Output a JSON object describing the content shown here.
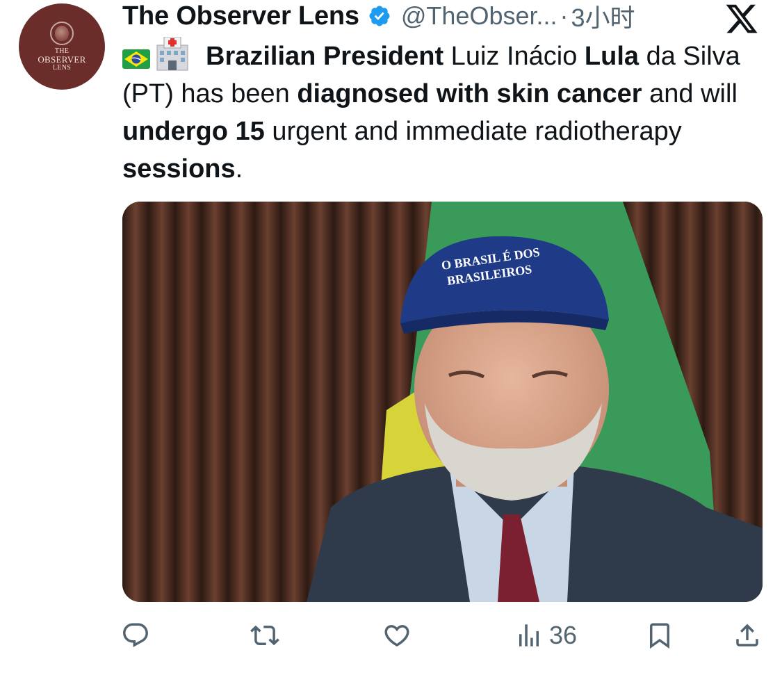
{
  "author": {
    "display_name": "The Observer Lens",
    "handle": "@TheObser...",
    "separator": "·",
    "time": "3小时",
    "avatar_text": [
      "THE",
      "OBSERVER",
      "LENS"
    ],
    "verified_color": "#1d9bf0"
  },
  "tweet": {
    "segments": [
      {
        "text": "Brazilian President",
        "bold": true
      },
      {
        "text": " Luiz Inácio ",
        "bold": false
      },
      {
        "text": "Lula",
        "bold": true
      },
      {
        "text": " da Silva (PT) has been ",
        "bold": false
      },
      {
        "text": "diagnosed with skin cancer",
        "bold": true
      },
      {
        "text": " and will ",
        "bold": false
      },
      {
        "text": "undergo 15",
        "bold": true
      },
      {
        "text": " urgent and immediate radiotherapy ",
        "bold": false
      },
      {
        "text": "sessions",
        "bold": true
      },
      {
        "text": ".",
        "bold": false
      }
    ],
    "emojis": [
      "brazil-flag-emoji",
      "hospital-emoji"
    ]
  },
  "media": {
    "cap_text_line1": "O BRASIL É DOS",
    "cap_text_line2": "BRASILEIROS"
  },
  "actions": {
    "reply": {
      "icon": "reply-icon",
      "count": ""
    },
    "retweet": {
      "icon": "retweet-icon",
      "count": ""
    },
    "like": {
      "icon": "heart-icon",
      "count": ""
    },
    "views": {
      "icon": "views-icon",
      "count": "36"
    },
    "bookmark": {
      "icon": "bookmark-icon",
      "count": ""
    },
    "share": {
      "icon": "share-icon",
      "count": ""
    }
  },
  "colors": {
    "text": "#0f1419",
    "secondary": "#536471",
    "avatar_bg": "#6b2d2a"
  }
}
